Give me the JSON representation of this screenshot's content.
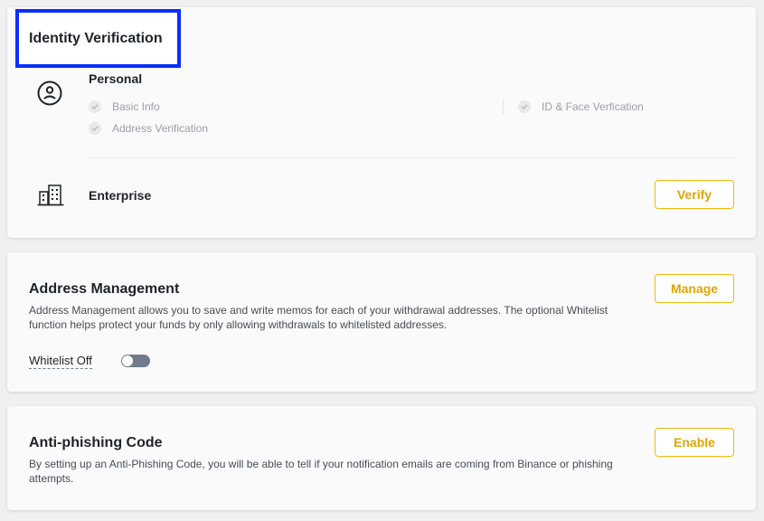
{
  "identity": {
    "title": "Identity Verification",
    "personal_label": "Personal",
    "items": [
      "Basic Info",
      "Address Verification",
      "ID & Face Verfication"
    ],
    "enterprise_label": "Enterprise",
    "verify_label": "Verify",
    "personal_icon": "user-circle-icon",
    "enterprise_icon": "building-icon",
    "check_icon": "check-icon"
  },
  "address": {
    "title": "Address Management",
    "description": "Address Management allows you to save and write memos for each of your withdrawal addresses. The optional Whitelist function helps protect your funds by only allowing withdrawals to whitelisted addresses.",
    "manage_label": "Manage",
    "whitelist_label": "Whitelist Off",
    "whitelist_on": false
  },
  "antiphish": {
    "title": "Anti-phishing Code",
    "description": "By setting up an Anti-Phishing Code, you will be able to tell if your notification emails are coming from Binance or phishing attempts.",
    "enable_label": "Enable"
  },
  "colors": {
    "accent": "#f0b90b",
    "highlight": "#0a2eff",
    "toggle_off": "#707a8a"
  }
}
